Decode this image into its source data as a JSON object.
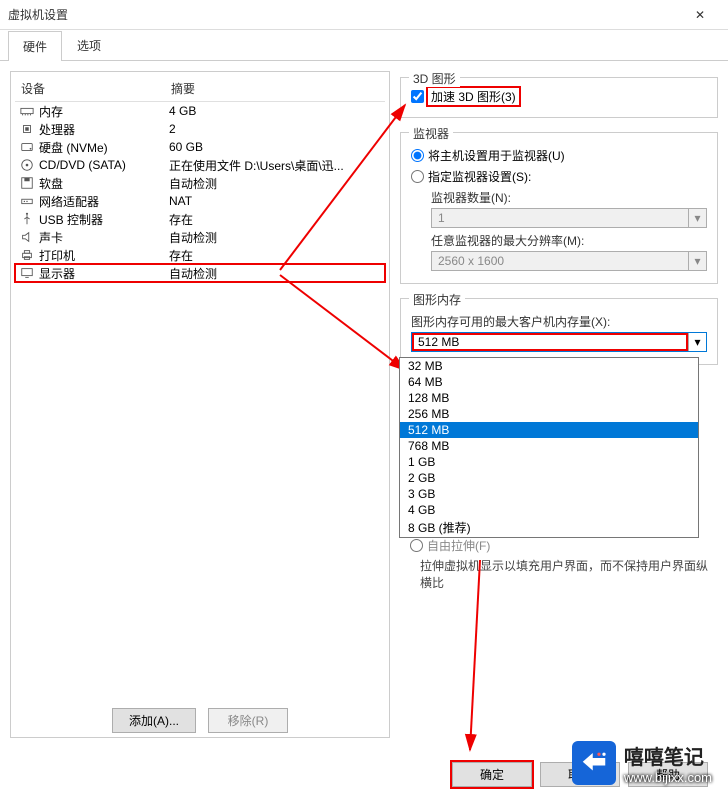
{
  "window": {
    "title": "虚拟机设置",
    "close": "✕"
  },
  "tabs": {
    "hardware": "硬件",
    "options": "选项"
  },
  "list": {
    "header_device": "设备",
    "header_summary": "摘要",
    "rows": [
      {
        "icon": "memory",
        "name": "内存",
        "summary": "4 GB"
      },
      {
        "icon": "cpu",
        "name": "处理器",
        "summary": "2"
      },
      {
        "icon": "disk",
        "name": "硬盘 (NVMe)",
        "summary": "60 GB"
      },
      {
        "icon": "cd",
        "name": "CD/DVD (SATA)",
        "summary": "正在使用文件 D:\\Users\\桌面\\迅..."
      },
      {
        "icon": "floppy",
        "name": "软盘",
        "summary": "自动检测"
      },
      {
        "icon": "net",
        "name": "网络适配器",
        "summary": "NAT"
      },
      {
        "icon": "usb",
        "name": "USB 控制器",
        "summary": "存在"
      },
      {
        "icon": "sound",
        "name": "声卡",
        "summary": "自动检测"
      },
      {
        "icon": "printer",
        "name": "打印机",
        "summary": "存在"
      },
      {
        "icon": "display",
        "name": "显示器",
        "summary": "自动检测"
      }
    ],
    "btn_add": "添加(A)...",
    "btn_remove": "移除(R)"
  },
  "gfx3d": {
    "title": "3D 图形",
    "accel_label": "加速 3D 图形(3)"
  },
  "monitor": {
    "title": "监视器",
    "use_host": "将主机设置用于监视器(U)",
    "specify": "指定监视器设置(S):",
    "count_label": "监视器数量(N):",
    "count_value": "1",
    "maxres_label": "任意监视器的最大分辨率(M):",
    "maxres_value": "2560 x 1600"
  },
  "gmem": {
    "title": "图形内存",
    "label": "图形内存可用的最大客户机内存量(X):",
    "value": "512 MB",
    "options": [
      "32 MB",
      "64 MB",
      "128 MB",
      "256 MB",
      "512 MB",
      "768 MB",
      "1 GB",
      "2 GB",
      "3 GB",
      "4 GB",
      "8 GB (推荐)"
    ]
  },
  "stretch": {
    "radio_label": "自由拉伸(F)",
    "desc": "拉伸虚拟机显示以填充用户界面，而不保持用户界面纵横比"
  },
  "footer": {
    "ok": "确定",
    "cancel": "取消",
    "help": "帮助"
  },
  "watermark": {
    "big": "嘻嘻笔记",
    "small": "www.bijixx.com"
  }
}
